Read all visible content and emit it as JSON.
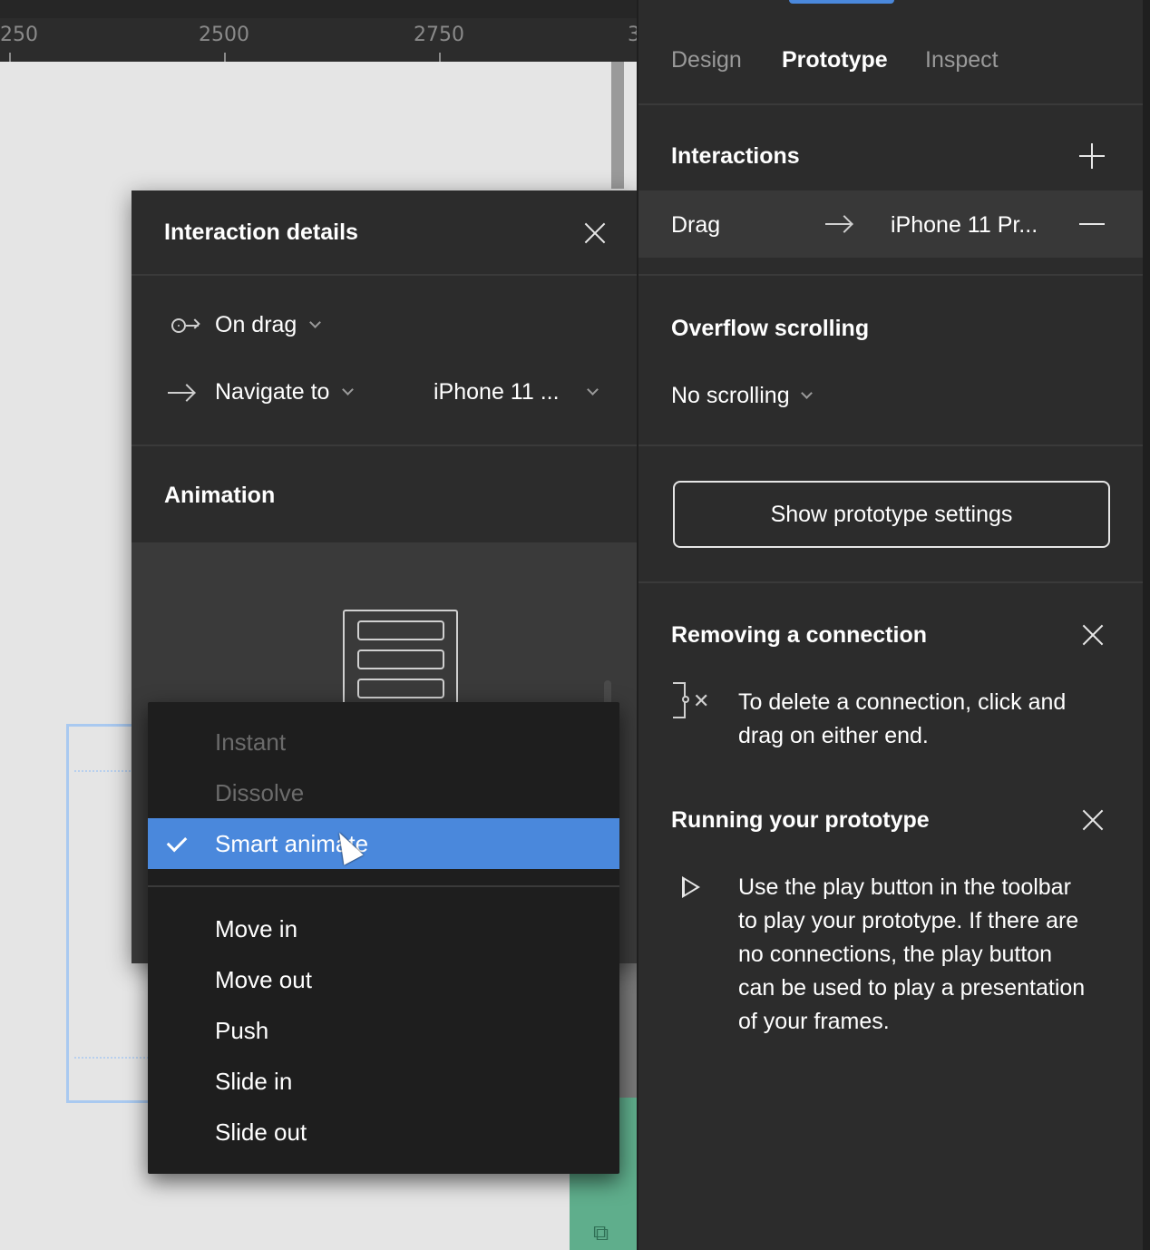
{
  "ruler": {
    "ticks": [
      "250",
      "2500",
      "2750",
      "3"
    ]
  },
  "interaction_details": {
    "title": "Interaction details",
    "trigger": {
      "label": "On drag",
      "icon": "drag-trigger-icon"
    },
    "action": {
      "label": "Navigate to",
      "icon": "arrow-right-icon"
    },
    "destination": "iPhone 11 ...",
    "animation_title": "Animation"
  },
  "animation_dropdown": {
    "disabled_items": [
      "Instant",
      "Dissolve"
    ],
    "selected": "Smart animate",
    "items": [
      "Move in",
      "Move out",
      "Push",
      "Slide in",
      "Slide out"
    ]
  },
  "right_panel": {
    "tabs": [
      {
        "label": "Design",
        "active": false
      },
      {
        "label": "Prototype",
        "active": true
      },
      {
        "label": "Inspect",
        "active": false
      }
    ],
    "interactions": {
      "title": "Interactions",
      "row": {
        "trigger": "Drag",
        "destination": "iPhone 11 Pr..."
      }
    },
    "overflow": {
      "title": "Overflow scrolling",
      "value": "No scrolling"
    },
    "settings_button": "Show prototype settings",
    "tips": [
      {
        "title": "Removing a connection",
        "text": "To delete a connection, click and drag on either end.",
        "icon": "connection-icon"
      },
      {
        "title": "Running your prototype",
        "text": "Use the play button in the toolbar to play your prototype. If there are no connections, the play button can be used to play a presentation of your frames.",
        "icon": "play-icon"
      }
    ]
  },
  "colors": {
    "panel_bg": "#2c2c2c",
    "accent": "#4a88dc",
    "canvas_bg": "#e5e5e5",
    "frame_green": "#5fae8c"
  }
}
